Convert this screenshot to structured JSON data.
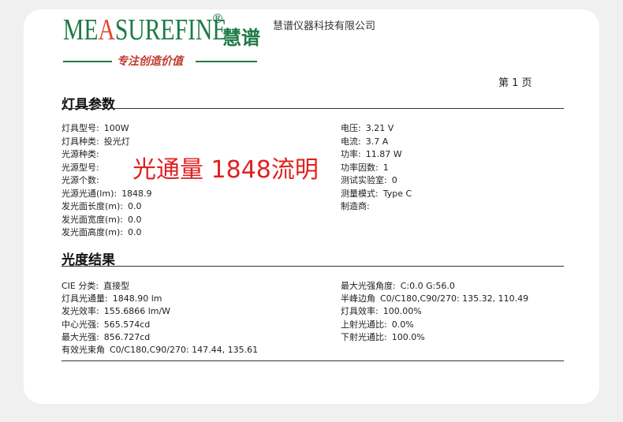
{
  "header": {
    "logo_text": "MEASUREFINE",
    "logo_reg": "®",
    "logo_cn": "慧谱",
    "slogan": "专注创造价值",
    "company": "慧谱仪器科技有限公司",
    "page_label": "第 1 页"
  },
  "colors": {
    "brand": "#1d7a46",
    "accent": "#e0482a",
    "overlay": "#e02020"
  },
  "lamp_section": {
    "title": "灯具参数",
    "left": [
      {
        "k": "灯具型号:",
        "v": "100W"
      },
      {
        "k": "灯具种类:",
        "v": "投光灯"
      },
      {
        "k": "光源种类:",
        "v": ""
      },
      {
        "k": "光源型号:",
        "v": ""
      },
      {
        "k": "光源个数:",
        "v": ""
      },
      {
        "k": "光源光通(lm):",
        "v": "1848.9"
      },
      {
        "k": "发光面长度(m):",
        "v": "0.0"
      },
      {
        "k": "发光面宽度(m):",
        "v": "0.0"
      },
      {
        "k": "发光面高度(m):",
        "v": "0.0"
      }
    ],
    "right": [
      {
        "k": "电压:",
        "v": "3.21 V"
      },
      {
        "k": "电流:",
        "v": "3.7  A"
      },
      {
        "k": "功率:",
        "v": "11.87 W"
      },
      {
        "k": "功率因数:",
        "v": "1"
      },
      {
        "k": "测试实验室:",
        "v": "0"
      },
      {
        "k": "测量模式:",
        "v": "Type C"
      },
      {
        "k": "制造商:",
        "v": ""
      }
    ]
  },
  "overlay_text": "光通量 1848流明",
  "result_section": {
    "title": "光度结果",
    "left": [
      {
        "k": "CIE 分类:",
        "v": "直接型"
      },
      {
        "k": "灯具光通量:",
        "v": "1848.90 lm"
      },
      {
        "k": "发光效率:",
        "v": "155.6866 lm/W"
      },
      {
        "k": "中心光强:",
        "v": "565.574cd"
      },
      {
        "k": "最大光强:",
        "v": "856.727cd"
      },
      {
        "k": "有效光束角",
        "v": "C0/C180,C90/270: 147.44, 135.61"
      }
    ],
    "right": [
      {
        "k": "最大光强角度:",
        "v": "C:0.0  G:56.0"
      },
      {
        "k": "半峰边角",
        "v": "C0/C180,C90/270: 135.32, 110.49"
      },
      {
        "k": "灯具效率:",
        "v": "100.00%"
      },
      {
        "k": "上射光通比:",
        "v": "0.0%"
      },
      {
        "k": "下射光通比:",
        "v": "100.0%"
      }
    ]
  }
}
